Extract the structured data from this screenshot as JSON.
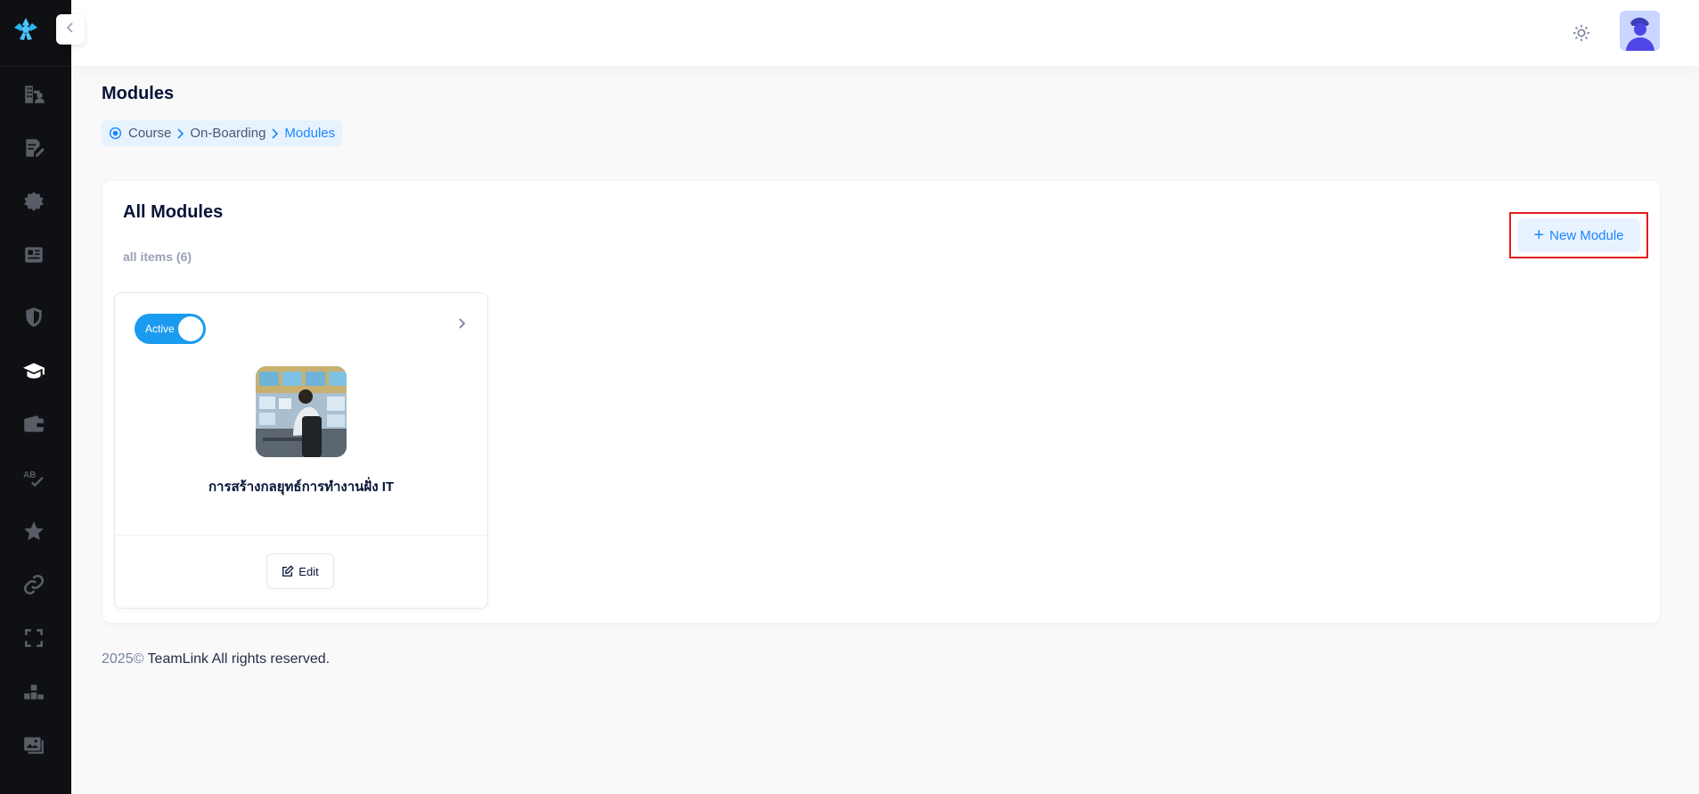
{
  "colors": {
    "sidebar_bg": "#0f1014",
    "accent": "#1b84ff",
    "toggle_on": "#1b9bf0",
    "highlight_border": "#e11d1d"
  },
  "sidebar": {
    "logo_icon": "teamlink-logo-icon",
    "items": [
      {
        "icon": "building-users-icon"
      },
      {
        "icon": "edit-document-icon"
      },
      {
        "icon": "badge-icon"
      },
      {
        "icon": "newspaper-icon"
      },
      {
        "icon": "shield-icon"
      },
      {
        "icon": "graduation-cap-icon",
        "active": true
      },
      {
        "icon": "wallet-icon"
      },
      {
        "icon": "spellcheck-icon"
      },
      {
        "icon": "star-icon"
      },
      {
        "icon": "link-icon"
      },
      {
        "icon": "fullscreen-icon"
      },
      {
        "icon": "leaderboard-icon"
      },
      {
        "icon": "gallery-icon"
      }
    ]
  },
  "header": {
    "theme_icon": "sun-icon",
    "avatar_icon": "user-avatar"
  },
  "page": {
    "title": "Modules",
    "breadcrumb": {
      "items": [
        "Course",
        "On-Boarding"
      ],
      "active": "Modules"
    }
  },
  "main": {
    "title": "All Modules",
    "subtitle": "all items (6)",
    "new_button_label": "New Module",
    "modules": [
      {
        "status": "Active",
        "title": "การสร้างกลยุทธ์การทำงานฝั่ง IT",
        "edit_label": "Edit"
      }
    ]
  },
  "footer": {
    "year": "2025©",
    "text": " TeamLink All rights reserved."
  }
}
